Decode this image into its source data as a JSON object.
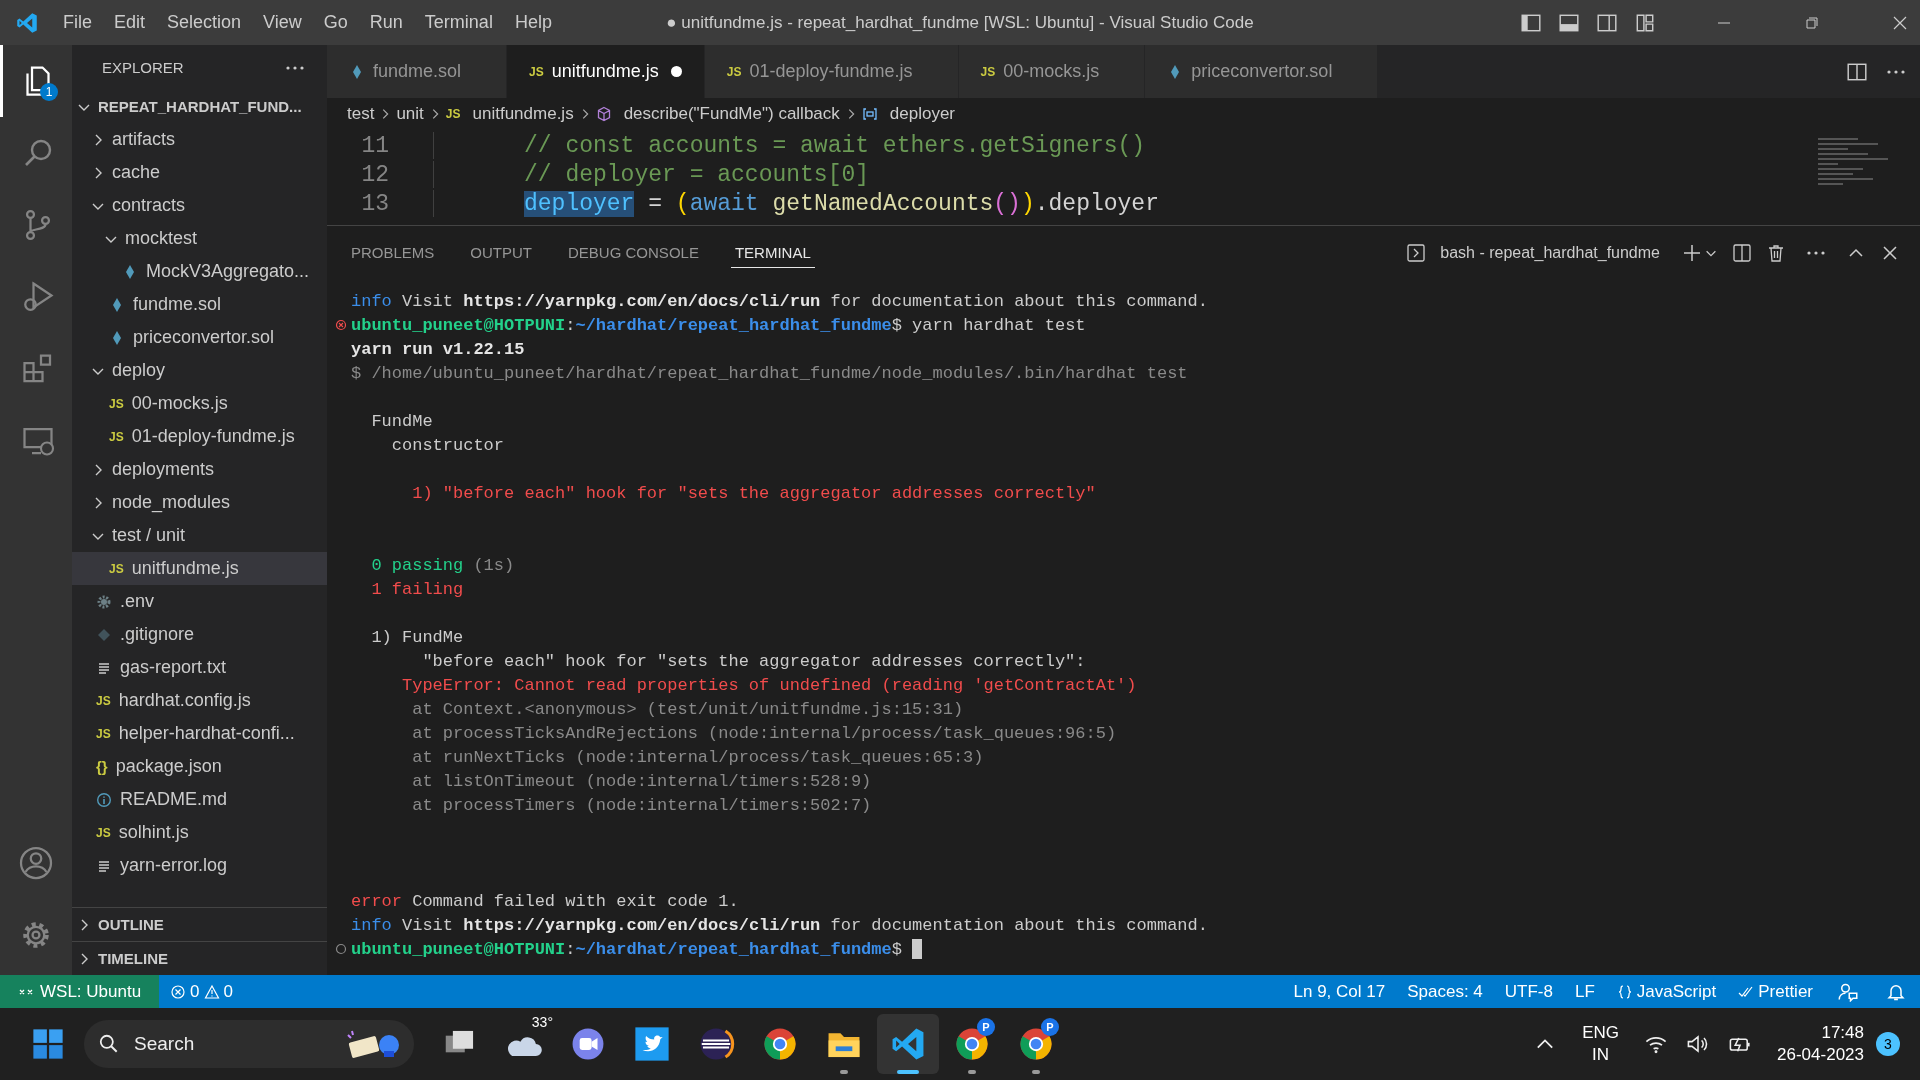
{
  "title_bar": {
    "menu": [
      "File",
      "Edit",
      "Selection",
      "View",
      "Go",
      "Run",
      "Terminal",
      "Help"
    ],
    "title": "● unitfundme.js - repeat_hardhat_fundme [WSL: Ubuntu] - Visual Studio Code"
  },
  "activity_bar": {
    "items": [
      {
        "kind": "explorer",
        "selected": true,
        "badge": "1"
      },
      {
        "kind": "search",
        "selected": false
      },
      {
        "kind": "source-control",
        "selected": false
      },
      {
        "kind": "run-debug",
        "selected": false
      },
      {
        "kind": "extensions",
        "selected": false
      },
      {
        "kind": "remote",
        "selected": false
      }
    ],
    "bottom": [
      {
        "kind": "account"
      },
      {
        "kind": "settings"
      }
    ]
  },
  "sidebar": {
    "title": "EXPLORER",
    "folder": {
      "label": "REPEAT_HARDHAT_FUND...",
      "expanded": true
    },
    "tree": [
      {
        "label": "artifacts",
        "kind": "folder",
        "expanded": false,
        "selected": false
      },
      {
        "label": "cache",
        "kind": "folder",
        "expanded": false,
        "selected": false
      },
      {
        "label": "contracts",
        "kind": "folder",
        "expanded": true,
        "selected": false,
        "children": [
          {
            "label": "mocktest",
            "kind": "folder",
            "expanded": true,
            "selected": false,
            "children": [
              {
                "label": "MockV3Aggregato...",
                "kind": "sol",
                "selected": false
              }
            ]
          },
          {
            "label": "fundme.sol",
            "kind": "sol",
            "selected": false
          },
          {
            "label": "priceconvertor.sol",
            "kind": "sol",
            "selected": false
          }
        ]
      },
      {
        "label": "deploy",
        "kind": "folder",
        "expanded": true,
        "selected": false,
        "children": [
          {
            "label": "00-mocks.js",
            "kind": "js",
            "badge": "JS",
            "selected": false
          },
          {
            "label": "01-deploy-fundme.js",
            "kind": "js",
            "badge": "JS",
            "selected": false
          }
        ]
      },
      {
        "label": "deployments",
        "kind": "folder",
        "expanded": false,
        "selected": false
      },
      {
        "label": "node_modules",
        "kind": "folder",
        "expanded": false,
        "selected": false
      },
      {
        "label": "test / unit",
        "kind": "folder",
        "expanded": true,
        "selected": false,
        "children": [
          {
            "label": "unitfundme.js",
            "kind": "js",
            "badge": "JS",
            "selected": true
          }
        ]
      },
      {
        "label": ".env",
        "kind": "env",
        "selected": false
      },
      {
        "label": ".gitignore",
        "kind": "git",
        "selected": false
      },
      {
        "label": "gas-report.txt",
        "kind": "text",
        "selected": false
      },
      {
        "label": "hardhat.config.js",
        "kind": "js",
        "badge": "JS",
        "selected": false
      },
      {
        "label": "helper-hardhat-confi...",
        "kind": "js",
        "badge": "JS",
        "selected": false
      },
      {
        "label": "package.json",
        "kind": "json",
        "badge": "{}",
        "selected": false
      },
      {
        "label": "README.md",
        "kind": "readme",
        "selected": false
      },
      {
        "label": "solhint.js",
        "kind": "js",
        "badge": "JS",
        "selected": false
      },
      {
        "label": "yarn-error.log",
        "kind": "text",
        "selected": false
      }
    ],
    "sections": [
      {
        "label": "OUTLINE",
        "expanded": false
      },
      {
        "label": "TIMELINE",
        "expanded": false
      }
    ]
  },
  "tabs": [
    {
      "label": "fundme.sol",
      "kind": "sol",
      "selected": false,
      "modified": false
    },
    {
      "label": "unitfundme.js",
      "kind": "js",
      "badge": "JS",
      "selected": true,
      "modified": true
    },
    {
      "label": "01-deploy-fundme.js",
      "kind": "js",
      "badge": "JS",
      "selected": false,
      "modified": false
    },
    {
      "label": "00-mocks.js",
      "kind": "js",
      "badge": "JS",
      "selected": false,
      "modified": false
    },
    {
      "label": "priceconvertor.sol",
      "kind": "sol",
      "selected": false,
      "modified": false
    }
  ],
  "breadcrumbs": [
    {
      "label": "test",
      "kind": "folder"
    },
    {
      "label": "unit",
      "kind": "folder"
    },
    {
      "label": "unitfundme.js",
      "kind": "js",
      "badge": "JS"
    },
    {
      "label": "describe(\"FundMe\") callback",
      "kind": "method"
    },
    {
      "label": "deployer",
      "kind": "variable"
    }
  ],
  "editor": {
    "lines": [
      {
        "number": "11",
        "tokens": [
          {
            "kind": "comment",
            "text": "// const accounts = await ethers.getSigners()"
          }
        ]
      },
      {
        "number": "12",
        "tokens": [
          {
            "kind": "comment",
            "text": "// deployer = accounts[0]"
          }
        ]
      },
      {
        "number": "13",
        "tokens": [
          {
            "kind": "variable",
            "text": "deployer",
            "highlighted": true
          },
          {
            "kind": "plain",
            "text": " = "
          },
          {
            "kind": "bracket1",
            "text": "("
          },
          {
            "kind": "keyword",
            "text": "await"
          },
          {
            "kind": "function",
            "text": "getNamedAccounts"
          },
          {
            "kind": "bracket2",
            "text": "()"
          },
          {
            "kind": "bracket1",
            "text": ")"
          },
          {
            "kind": "plain",
            "text": ".deployer"
          }
        ]
      }
    ]
  },
  "panel": {
    "tabs": [
      {
        "label": "PROBLEMS",
        "selected": false
      },
      {
        "label": "OUTPUT",
        "selected": false
      },
      {
        "label": "DEBUG CONSOLE",
        "selected": false
      },
      {
        "label": "TERMINAL",
        "selected": true
      }
    ],
    "terminal_name": "bash - repeat_hardhat_fundme",
    "lines": [
      {
        "kind": "output",
        "segments": [
          {
            "kind": "info",
            "text": "info"
          },
          {
            "kind": "text",
            "text": " Visit "
          },
          {
            "kind": "bold",
            "text": "https://yarnpkg.com/en/docs/cli/run"
          },
          {
            "kind": "text",
            "text": " for documentation about this command."
          }
        ]
      },
      {
        "kind": "command",
        "failed": true,
        "segments": [
          {
            "kind": "prompt",
            "text": "ubuntu_puneet@HOTPUNI"
          },
          {
            "kind": "text",
            "text": ":"
          },
          {
            "kind": "path",
            "text": "~/hardhat/repeat_hardhat_fundme"
          },
          {
            "kind": "text",
            "text": "$ yarn hardhat test"
          }
        ]
      },
      {
        "kind": "output",
        "segments": [
          {
            "kind": "bold",
            "text": "yarn run v1.22.15"
          }
        ]
      },
      {
        "kind": "output",
        "segments": [
          {
            "kind": "dim",
            "text": "$ /home/ubuntu_puneet/hardhat/repeat_hardhat_fundme/node_modules/.bin/hardhat test"
          }
        ]
      },
      {
        "kind": "blank"
      },
      {
        "kind": "output",
        "segments": [
          {
            "kind": "text",
            "text": "  FundMe"
          }
        ]
      },
      {
        "kind": "output",
        "segments": [
          {
            "kind": "text",
            "text": "    constructor"
          }
        ]
      },
      {
        "kind": "blank"
      },
      {
        "kind": "output",
        "segments": [
          {
            "kind": "red",
            "text": "      1) \"before each\" hook for \"sets the aggregator addresses correctly\""
          }
        ]
      },
      {
        "kind": "blank"
      },
      {
        "kind": "blank"
      },
      {
        "kind": "output",
        "segments": [
          {
            "kind": "green",
            "text": "  0 passing"
          },
          {
            "kind": "dim",
            "text": " (1s)"
          }
        ]
      },
      {
        "kind": "output",
        "segments": [
          {
            "kind": "red",
            "text": "  1 failing"
          }
        ]
      },
      {
        "kind": "blank"
      },
      {
        "kind": "output",
        "segments": [
          {
            "kind": "text",
            "text": "  1) FundMe"
          }
        ]
      },
      {
        "kind": "output",
        "segments": [
          {
            "kind": "text",
            "text": "       \"before each\" hook for \"sets the aggregator addresses correctly\":"
          }
        ]
      },
      {
        "kind": "output",
        "segments": [
          {
            "kind": "red",
            "text": "     TypeError: Cannot read properties of undefined (reading 'getContractAt')"
          }
        ]
      },
      {
        "kind": "output",
        "segments": [
          {
            "kind": "dim",
            "text": "      at Context.<anonymous> (test/unit/unitfundme.js:15:31)"
          }
        ]
      },
      {
        "kind": "output",
        "segments": [
          {
            "kind": "dim",
            "text": "      at processTicksAndRejections (node:internal/process/task_queues:96:5)"
          }
        ]
      },
      {
        "kind": "output",
        "segments": [
          {
            "kind": "dim",
            "text": "      at runNextTicks (node:internal/process/task_queues:65:3)"
          }
        ]
      },
      {
        "kind": "output",
        "segments": [
          {
            "kind": "dim",
            "text": "      at listOnTimeout (node:internal/timers:528:9)"
          }
        ]
      },
      {
        "kind": "output",
        "segments": [
          {
            "kind": "dim",
            "text": "      at processTimers (node:internal/timers:502:7)"
          }
        ]
      },
      {
        "kind": "blank"
      },
      {
        "kind": "blank"
      },
      {
        "kind": "blank"
      },
      {
        "kind": "output",
        "segments": [
          {
            "kind": "error",
            "text": "error"
          },
          {
            "kind": "text",
            "text": " Command failed with exit code 1."
          }
        ]
      },
      {
        "kind": "output",
        "segments": [
          {
            "kind": "info",
            "text": "info"
          },
          {
            "kind": "text",
            "text": " Visit "
          },
          {
            "kind": "bold",
            "text": "https://yarnpkg.com/en/docs/cli/run"
          },
          {
            "kind": "text",
            "text": " for documentation about this command."
          }
        ]
      },
      {
        "kind": "command",
        "failed": false,
        "cursor": true,
        "segments": [
          {
            "kind": "prompt",
            "text": "ubuntu_puneet@HOTPUNI"
          },
          {
            "kind": "text",
            "text": ":"
          },
          {
            "kind": "path",
            "text": "~/hardhat/repeat_hardhat_fundme"
          },
          {
            "kind": "text",
            "text": "$"
          }
        ]
      }
    ]
  },
  "status_bar": {
    "remote": "WSL: Ubuntu",
    "errors": "0",
    "warnings": "0",
    "items": [
      {
        "kind": "text",
        "label": "Ln 9, Col 17"
      },
      {
        "kind": "text",
        "label": "Spaces: 4"
      },
      {
        "kind": "text",
        "label": "UTF-8"
      },
      {
        "kind": "text",
        "label": "LF"
      },
      {
        "kind": "language",
        "label": "JavaScript"
      },
      {
        "kind": "formatter",
        "label": "Prettier"
      },
      {
        "kind": "feedback"
      },
      {
        "kind": "bell"
      }
    ]
  },
  "taskbar": {
    "search": "Search",
    "apps": [
      {
        "kind": "task-view",
        "running": false,
        "selected": false
      },
      {
        "kind": "weather",
        "label": "33°",
        "running": false,
        "selected": false
      },
      {
        "kind": "chat",
        "running": false,
        "selected": false
      },
      {
        "kind": "bird",
        "running": false,
        "selected": false
      },
      {
        "kind": "eclipse",
        "running": false,
        "selected": false
      },
      {
        "kind": "chrome",
        "running": false,
        "selected": false
      },
      {
        "kind": "folder",
        "running": true,
        "selected": false
      },
      {
        "kind": "vscode",
        "running": true,
        "selected": true
      },
      {
        "kind": "chrome",
        "badge": "P",
        "running": true,
        "selected": false
      },
      {
        "kind": "chrome",
        "badge": "P",
        "running": true,
        "selected": false
      }
    ],
    "language": [
      "ENG",
      "IN"
    ],
    "time": "17:48",
    "date": "26-04-2023",
    "notifications": "3"
  }
}
